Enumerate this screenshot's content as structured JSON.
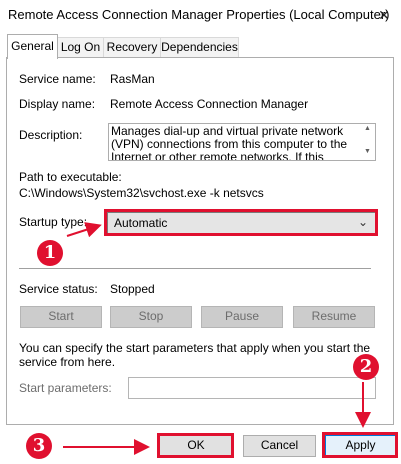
{
  "window": {
    "title": "Remote Access Connection Manager Properties (Local Computer)",
    "close_glyph": "✕"
  },
  "tabs": [
    "General",
    "Log On",
    "Recovery",
    "Dependencies"
  ],
  "general": {
    "service_name_label": "Service name:",
    "service_name_value": "RasMan",
    "display_name_label": "Display name:",
    "display_name_value": "Remote Access Connection Manager",
    "description_label": "Description:",
    "description_value": "Manages dial-up and virtual private network (VPN) connections from this computer to the Internet or other remote networks. If this service is disabled, any",
    "path_label": "Path to executable:",
    "path_value": "C:\\Windows\\System32\\svchost.exe -k netsvcs",
    "startup_type_label": "Startup type:",
    "startup_type_value": "Automatic",
    "service_status_label": "Service status:",
    "service_status_value": "Stopped",
    "buttons": {
      "start": "Start",
      "stop": "Stop",
      "pause": "Pause",
      "resume": "Resume"
    },
    "help_text": "You can specify the start parameters that apply when you start the service from here.",
    "start_params_label": "Start parameters:",
    "start_params_value": ""
  },
  "dialog_buttons": {
    "ok": "OK",
    "cancel": "Cancel",
    "apply": "Apply"
  },
  "annotations": {
    "badge1": "1",
    "badge2": "2",
    "badge3": "3",
    "color": "#e0102f"
  }
}
